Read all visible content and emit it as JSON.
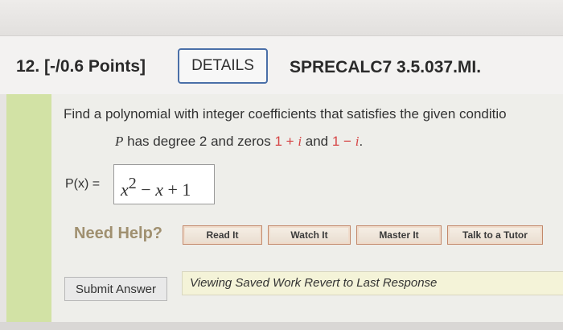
{
  "question": {
    "number_label": "12. [-/0.6 Points]",
    "details_label": "DETAILS",
    "code": "SPRECALC7 3.5.037.MI."
  },
  "problem": {
    "prompt": "Find a polynomial with integer coefficients that satisfies the given conditio",
    "variable": "P",
    "condition_mid": " has degree 2 and zeros ",
    "zero1_a": "1 + ",
    "zero1_i": "i",
    "condition_and": " and ",
    "zero2_a": "1 − ",
    "zero2_i": "i",
    "condition_end": "."
  },
  "answer": {
    "label": "P(x) =",
    "term1_var": "x",
    "term1_exp": "2",
    "term2": " − ",
    "term2_var": "x",
    "term3": " + 1"
  },
  "help": {
    "label": "Need Help?",
    "buttons": [
      "Read It",
      "Watch It",
      "Master It",
      "Talk to a Tutor"
    ]
  },
  "submit_label": "Submit Answer",
  "saved_banner": "Viewing Saved Work Revert to Last Response",
  "colors": {
    "accent_green": "#d2e2a5",
    "zero_red": "#d64545",
    "details_border": "#4a6fa8",
    "help_text": "#a09070"
  }
}
